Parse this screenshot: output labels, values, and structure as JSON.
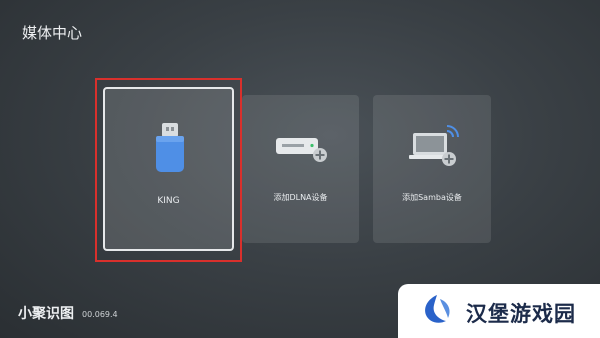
{
  "page": {
    "title": "媒体中心"
  },
  "devices": [
    {
      "label": "KING",
      "icon": "usb-drive-icon",
      "selected": true
    },
    {
      "label": "添加DLNA设备",
      "icon": "dlna-server-add-icon",
      "selected": false
    },
    {
      "label": "添加Samba设备",
      "icon": "samba-laptop-add-icon",
      "selected": false
    }
  ],
  "footer": {
    "brand": "小聚识图",
    "version": "00.069.4"
  },
  "watermark": {
    "text": "汉堡游戏园"
  },
  "colors": {
    "focus": "#d9302c",
    "usb_blue": "#4f8fe6"
  }
}
